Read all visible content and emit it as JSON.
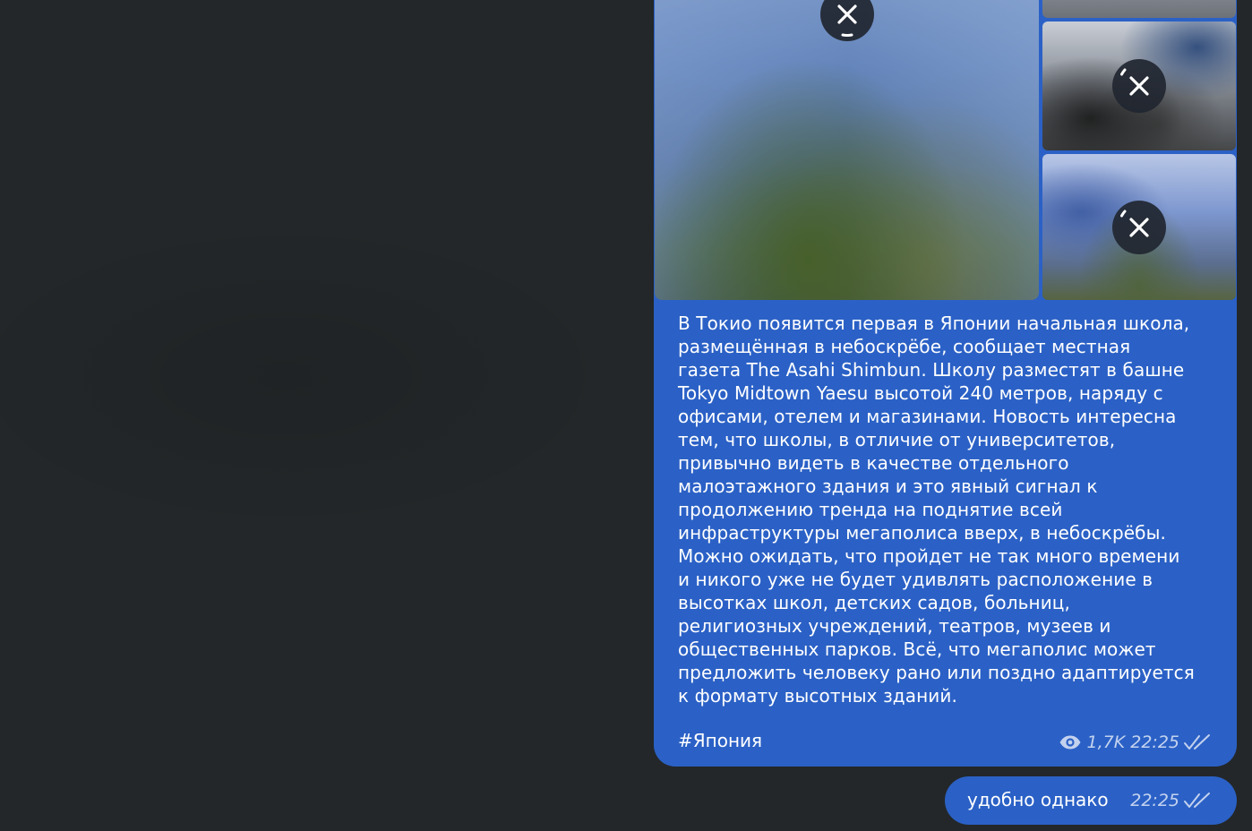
{
  "post": {
    "text": "В Токио появится первая в Японии начальная школа,\nразмещённая в небоскрёбе, сообщает местная\nгазета The Asahi Shimbun. Школу разместят в башне\nTokyo Midtown Yaesu высотой 240 метров, наряду с\nофисами, отелем и магазинами. Новость интересна\nтем, что школы, в отличие от университетов,\nпривычно видеть в качестве отдельного\nмалоэтажного здания и это явный сигнал к\nпродолжению тренда на поднятие всей\nинфраструктуры мегаполиса вверх, в небоскрёбы.\nМожно ожидать, что пройдет не так много времени\nи никого уже не будет удивлять расположение в\nвысотках школ, детских садов, больниц,\nрелигиозных учреждений, театров, музеев и\nобщественных парков. Всё, что мегаполис может\nпредложить человеку рано или поздно адаптируется\nк формату высотных зданий.",
    "hashtag": "#Япония",
    "views": "1,7K",
    "time": "22:25",
    "views_icon": "eye-icon",
    "status_icon": "double-check-icon",
    "photo_count": 4,
    "photo_action_icon": "close-icon"
  },
  "message": {
    "text": "удобно однако",
    "time": "22:25",
    "status_icon": "double-check-icon"
  },
  "colors": {
    "background": "#232729",
    "bubble": "#2b61c6",
    "text": "#ffffff",
    "meta_text": "#c4d2ee"
  }
}
